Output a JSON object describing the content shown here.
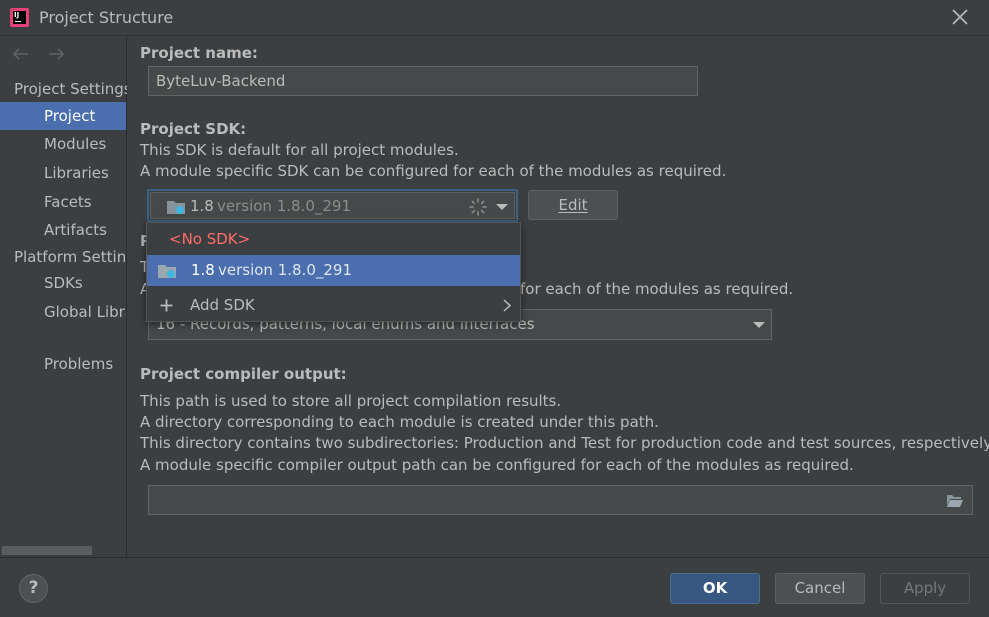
{
  "window": {
    "title": "Project Structure",
    "app_icon_text": "IJ"
  },
  "sidebar": {
    "sections": [
      {
        "label": "Project Settings"
      },
      {
        "label": "Platform Settings"
      }
    ],
    "items": [
      {
        "label": "Project",
        "selected": true
      },
      {
        "label": "Modules"
      },
      {
        "label": "Libraries"
      },
      {
        "label": "Facets"
      },
      {
        "label": "Artifacts"
      },
      {
        "label": "SDKs"
      },
      {
        "label": "Global Libraries"
      },
      {
        "label": "Problems"
      }
    ]
  },
  "main": {
    "project_name": {
      "label": "Project name:",
      "value": "ByteLuv-Backend"
    },
    "sdk": {
      "label": "Project SDK:",
      "desc1": "This SDK is default for all project modules.",
      "desc2": "A module specific SDK can be configured for each of the modules as required.",
      "selected_name": "1.8",
      "selected_version": "version 1.8.0_291",
      "edit_label": "Edit"
    },
    "language_level": {
      "label_fragment": "P",
      "desc_fragment1": "T",
      "desc_fragment2": "A",
      "desc_tail": "for each of the modules as required.",
      "value": "16 - Records, patterns, local enums and interfaces"
    },
    "compiler_output": {
      "label": "Project compiler output:",
      "lines": [
        "This path is used to store all project compilation results.",
        "A directory corresponding to each module is created under this path.",
        "This directory contains two subdirectories: Production and Test for production code and test sources, respectively.",
        "A module specific compiler output path can be configured for each of the modules as required."
      ],
      "value": ""
    }
  },
  "sdk_popup": {
    "no_sdk": "<No SDK>",
    "option_name": "1.8",
    "option_version": "version 1.8.0_291",
    "add_sdk": "Add SDK"
  },
  "footer": {
    "help": "?",
    "ok": "OK",
    "cancel": "Cancel",
    "apply": "Apply"
  },
  "colors": {
    "background": "#3c3f41",
    "selection": "#4b6eaf",
    "no_sdk_red": "#ff6b68",
    "focus_border": "#3d6185"
  },
  "icons": [
    "app-icon",
    "close-icon",
    "back-arrow-icon",
    "forward-arrow-icon",
    "folder-icon",
    "spinner-icon",
    "chevron-down-icon",
    "plus-icon",
    "chevron-right-icon",
    "folder-open-icon",
    "help-icon"
  ]
}
